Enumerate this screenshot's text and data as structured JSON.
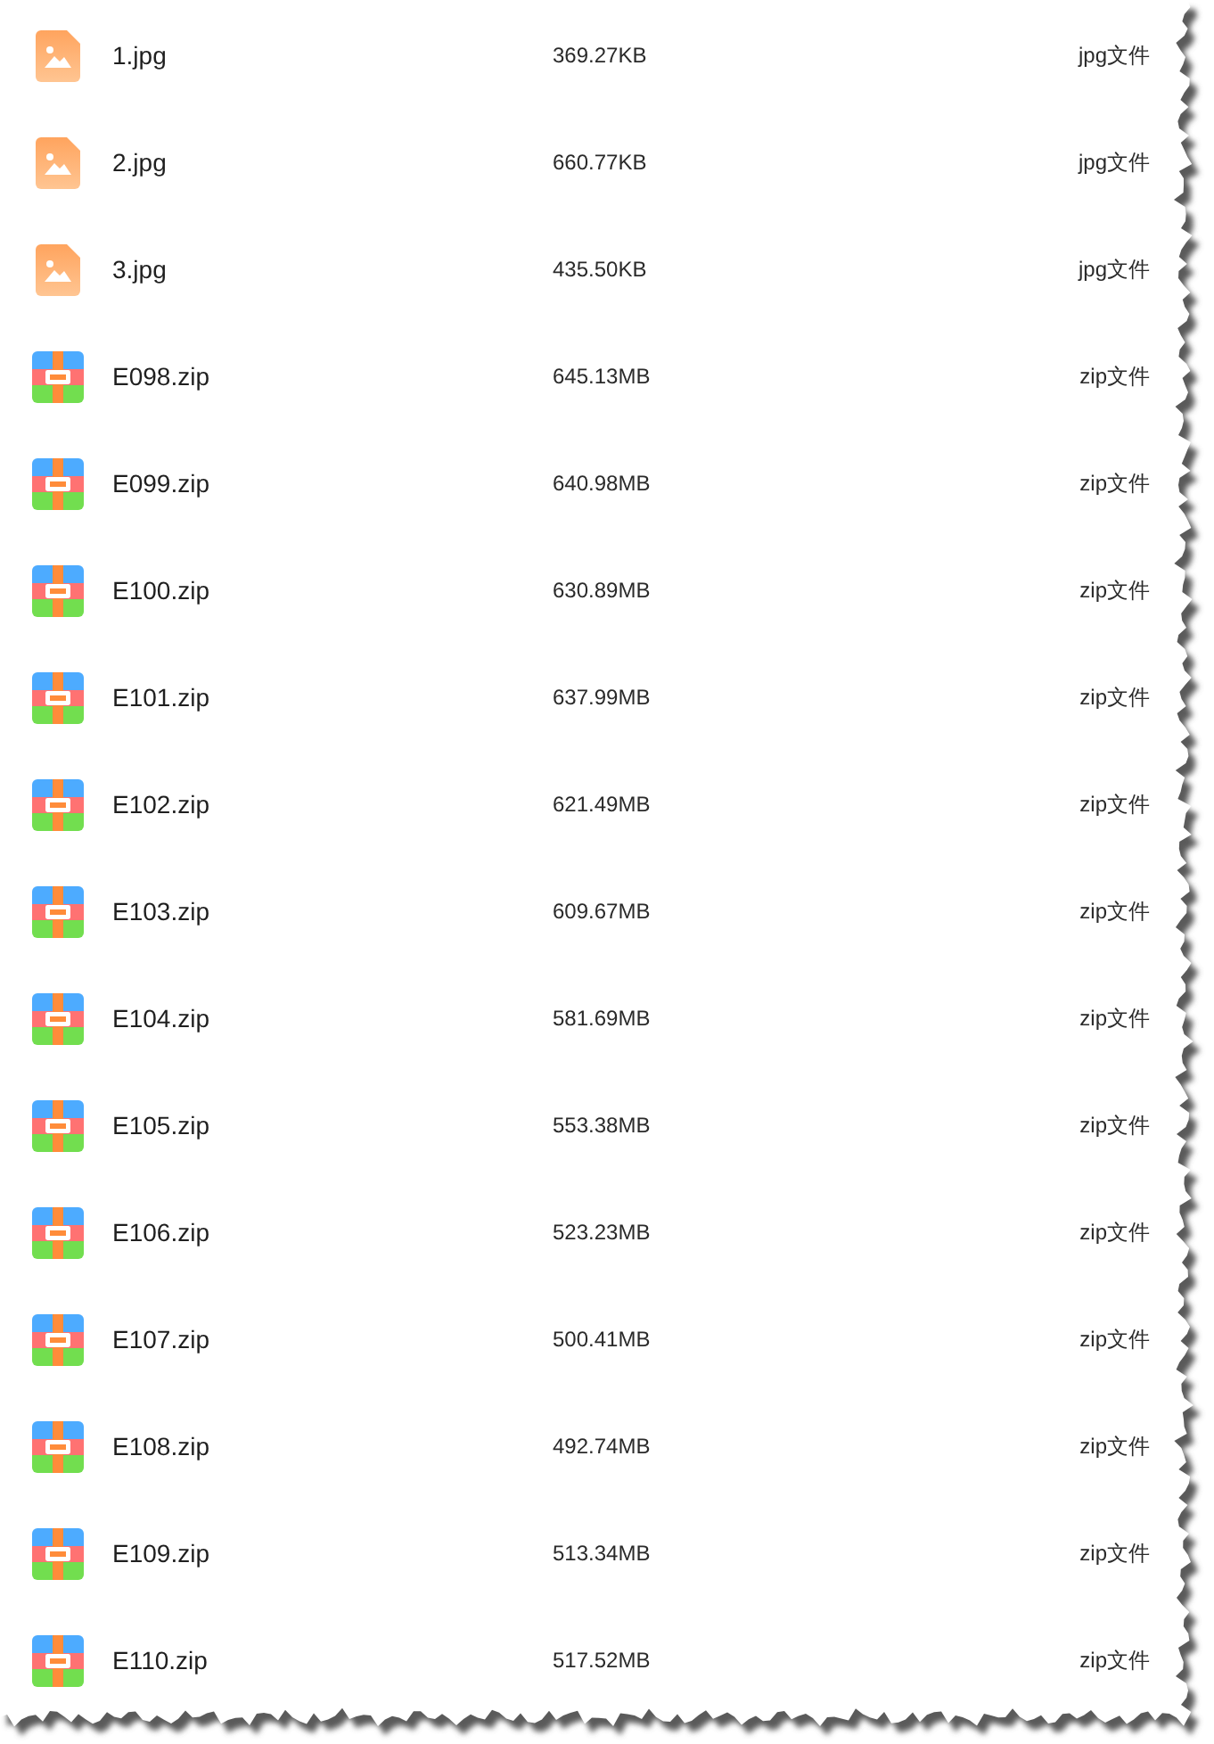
{
  "files": [
    {
      "kind": "image",
      "name": "1.jpg",
      "size": "369.27KB",
      "type": "jpg文件"
    },
    {
      "kind": "image",
      "name": "2.jpg",
      "size": "660.77KB",
      "type": "jpg文件"
    },
    {
      "kind": "image",
      "name": "3.jpg",
      "size": "435.50KB",
      "type": "jpg文件"
    },
    {
      "kind": "archive",
      "name": "E098.zip",
      "size": "645.13MB",
      "type": "zip文件"
    },
    {
      "kind": "archive",
      "name": "E099.zip",
      "size": "640.98MB",
      "type": "zip文件"
    },
    {
      "kind": "archive",
      "name": "E100.zip",
      "size": "630.89MB",
      "type": "zip文件"
    },
    {
      "kind": "archive",
      "name": "E101.zip",
      "size": "637.99MB",
      "type": "zip文件"
    },
    {
      "kind": "archive",
      "name": "E102.zip",
      "size": "621.49MB",
      "type": "zip文件"
    },
    {
      "kind": "archive",
      "name": "E103.zip",
      "size": "609.67MB",
      "type": "zip文件"
    },
    {
      "kind": "archive",
      "name": "E104.zip",
      "size": "581.69MB",
      "type": "zip文件"
    },
    {
      "kind": "archive",
      "name": "E105.zip",
      "size": "553.38MB",
      "type": "zip文件"
    },
    {
      "kind": "archive",
      "name": "E106.zip",
      "size": "523.23MB",
      "type": "zip文件"
    },
    {
      "kind": "archive",
      "name": "E107.zip",
      "size": "500.41MB",
      "type": "zip文件"
    },
    {
      "kind": "archive",
      "name": "E108.zip",
      "size": "492.74MB",
      "type": "zip文件"
    },
    {
      "kind": "archive",
      "name": "E109.zip",
      "size": "513.34MB",
      "type": "zip文件"
    },
    {
      "kind": "archive",
      "name": "E110.zip",
      "size": "517.52MB",
      "type": "zip文件"
    }
  ]
}
